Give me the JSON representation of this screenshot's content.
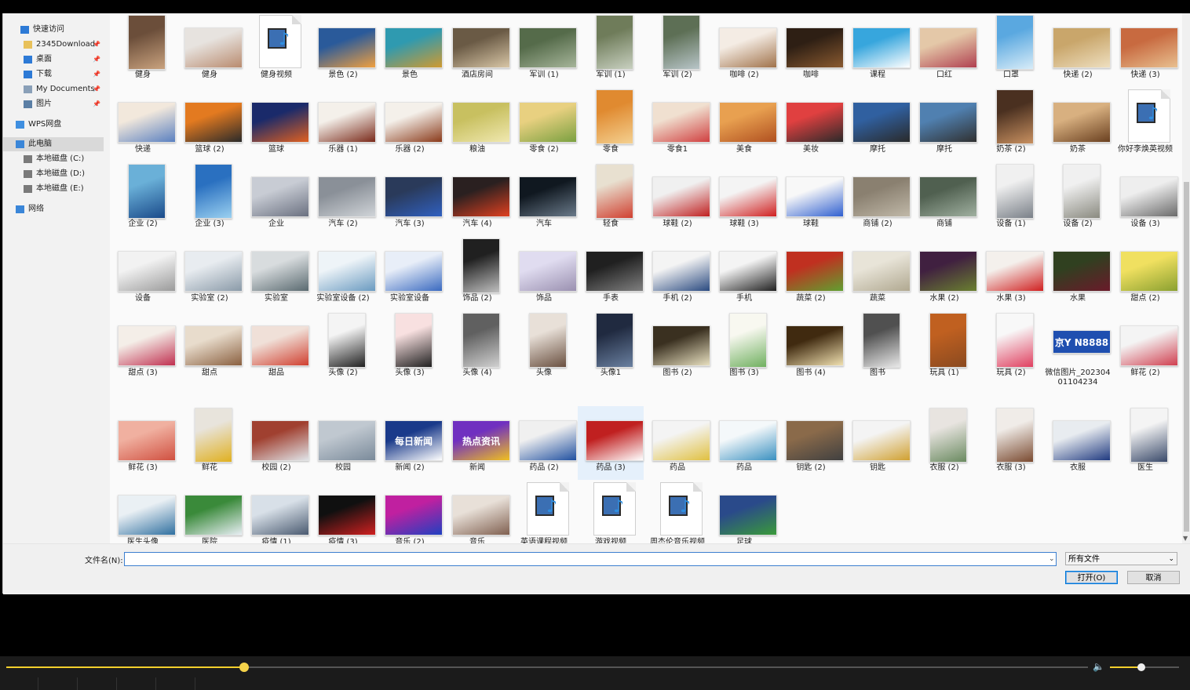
{
  "nav": {
    "items": [
      {
        "label": "快速访问",
        "icon": "star-icon",
        "color": "#2d7ad6",
        "pinned": false
      },
      {
        "label": "2345Download",
        "icon": "folder-icon",
        "color": "#e8c15a",
        "pinned": true
      },
      {
        "label": "桌面",
        "icon": "desktop-icon",
        "color": "#2d7ad6",
        "pinned": true
      },
      {
        "label": "下载",
        "icon": "download-icon",
        "color": "#2d7ad6",
        "pinned": true
      },
      {
        "label": "My Documents",
        "icon": "document-icon",
        "color": "#8aa0b8",
        "pinned": true
      },
      {
        "label": "图片",
        "icon": "pictures-icon",
        "color": "#5b7fa5",
        "pinned": true
      },
      {
        "label": "WPS网盘",
        "icon": "cloud-icon",
        "color": "#3f8fe0",
        "pinned": false
      },
      {
        "label": "此电脑",
        "icon": "computer-icon",
        "color": "#3a86d8",
        "pinned": false
      },
      {
        "label": "本地磁盘 (C:)",
        "icon": "drive-c-icon",
        "color": "#7a7a7a",
        "pinned": false
      },
      {
        "label": "本地磁盘 (D:)",
        "icon": "drive-icon",
        "color": "#7a7a7a",
        "pinned": false
      },
      {
        "label": "本地磁盘 (E:)",
        "icon": "drive-icon",
        "color": "#7a7a7a",
        "pinned": false
      },
      {
        "label": "网络",
        "icon": "network-icon",
        "color": "#3a86d8",
        "pinned": false
      }
    ],
    "pin_glyph": "📌"
  },
  "files": [
    [
      {
        "label": "健身",
        "kind": "tall",
        "c1": "#6b4e3a",
        "c2": "#c9a27e"
      },
      {
        "label": "健身",
        "kind": "image",
        "c1": "#e7e3df",
        "c2": "#b98b6f"
      },
      {
        "label": "健身视频",
        "kind": "video"
      },
      {
        "label": "景色 (2)",
        "kind": "image",
        "c1": "#2a5a9a",
        "c2": "#f0a040"
      },
      {
        "label": "景色",
        "kind": "image",
        "c1": "#2f9ab0",
        "c2": "#d09a30"
      },
      {
        "label": "酒店房间",
        "kind": "image",
        "c1": "#6a5a45",
        "c2": "#d8c6a6"
      },
      {
        "label": "军训 (1)",
        "kind": "image",
        "c1": "#556b4a",
        "c2": "#a6b59a"
      },
      {
        "label": "军训 (1)",
        "kind": "tall",
        "c1": "#6f7c5a",
        "c2": "#c8d0c0"
      },
      {
        "label": "军训 (2)",
        "kind": "tall",
        "c1": "#5d6f55",
        "c2": "#b8c5c8"
      },
      {
        "label": "咖啡 (2)",
        "kind": "image",
        "c1": "#f4ece4",
        "c2": "#a0724a"
      },
      {
        "label": "咖啡",
        "kind": "image",
        "c1": "#2e1f14",
        "c2": "#8a5a30"
      },
      {
        "label": "课程",
        "kind": "image",
        "c1": "#37a6dd",
        "c2": "#ffffff"
      },
      {
        "label": "口红",
        "kind": "image",
        "c1": "#e4c8a8",
        "c2": "#b04050"
      },
      {
        "label": "口罩",
        "kind": "tall",
        "c1": "#5aa8e0",
        "c2": "#d8ecf8"
      },
      {
        "label": "快递 (2)",
        "kind": "image",
        "c1": "#c9a66b",
        "c2": "#eedfc0"
      },
      {
        "label": "快递 (3)",
        "kind": "image",
        "c1": "#c86a40",
        "c2": "#e8c090"
      }
    ],
    [
      {
        "label": "快递",
        "kind": "image",
        "c1": "#f2e8dc",
        "c2": "#5a80c0"
      },
      {
        "label": "篮球 (2)",
        "kind": "image",
        "c1": "#e37a20",
        "c2": "#2a2a2a"
      },
      {
        "label": "篮球",
        "kind": "image",
        "c1": "#1a2a6a",
        "c2": "#e06020"
      },
      {
        "label": "乐器 (1)",
        "kind": "image",
        "c1": "#f4f0ea",
        "c2": "#7a2a1a"
      },
      {
        "label": "乐器 (2)",
        "kind": "image",
        "c1": "#f4f0ea",
        "c2": "#8a3a1a"
      },
      {
        "label": "粮油",
        "kind": "image",
        "c1": "#c8c060",
        "c2": "#f0e8b0"
      },
      {
        "label": "零食 (2)",
        "kind": "image",
        "c1": "#e8d080",
        "c2": "#7aa040"
      },
      {
        "label": "零食",
        "kind": "tall",
        "c1": "#e08a30",
        "c2": "#f4d090"
      },
      {
        "label": "零食1",
        "kind": "image",
        "c1": "#f0e0d0",
        "c2": "#d04040"
      },
      {
        "label": "美食",
        "kind": "image",
        "c1": "#e8a050",
        "c2": "#b05020"
      },
      {
        "label": "美妆",
        "kind": "image",
        "c1": "#e04040",
        "c2": "#2a2a2a"
      },
      {
        "label": "摩托",
        "kind": "image",
        "c1": "#3060a0",
        "c2": "#2a2a2a"
      },
      {
        "label": "摩托",
        "kind": "image",
        "c1": "#5080b0",
        "c2": "#303030"
      },
      {
        "label": "奶茶 (2)",
        "kind": "tall",
        "c1": "#4a3020",
        "c2": "#c89060"
      },
      {
        "label": "奶茶",
        "kind": "image",
        "c1": "#d8b080",
        "c2": "#6a4020"
      },
      {
        "label": "你好李焕英视频",
        "kind": "video"
      }
    ],
    [
      {
        "label": "企业 (2)",
        "kind": "tall",
        "c1": "#6ab0d8",
        "c2": "#1a4a8a"
      },
      {
        "label": "企业 (3)",
        "kind": "tall",
        "c1": "#2a70c0",
        "c2": "#9ad0f0"
      },
      {
        "label": "企业",
        "kind": "image",
        "c1": "#c8ccd4",
        "c2": "#6a7080"
      },
      {
        "label": "汽车 (2)",
        "kind": "image",
        "c1": "#8a9098",
        "c2": "#d0d4d8"
      },
      {
        "label": "汽车 (3)",
        "kind": "image",
        "c1": "#2a3a5a",
        "c2": "#3060c0"
      },
      {
        "label": "汽车 (4)",
        "kind": "image",
        "c1": "#2a2020",
        "c2": "#e04020"
      },
      {
        "label": "汽车",
        "kind": "image",
        "c1": "#101820",
        "c2": "#6a7a8a"
      },
      {
        "label": "轻食",
        "kind": "tall",
        "c1": "#e8e0d0",
        "c2": "#d04030"
      },
      {
        "label": "球鞋 (2)",
        "kind": "image",
        "c1": "#f0f0f0",
        "c2": "#c02020"
      },
      {
        "label": "球鞋 (3)",
        "kind": "image",
        "c1": "#f4f4f4",
        "c2": "#d02020"
      },
      {
        "label": "球鞋",
        "kind": "image",
        "c1": "#f8f8f8",
        "c2": "#3060d0"
      },
      {
        "label": "商铺 (2)",
        "kind": "image",
        "c1": "#8a8070",
        "c2": "#c0b8a8"
      },
      {
        "label": "商铺",
        "kind": "image",
        "c1": "#506050",
        "c2": "#a0b0a0"
      },
      {
        "label": "设备 (1)",
        "kind": "tall",
        "c1": "#f0f0f0",
        "c2": "#7a8088"
      },
      {
        "label": "设备 (2)",
        "kind": "tall",
        "c1": "#f0f0f0",
        "c2": "#8a8a80"
      },
      {
        "label": "设备 (3)",
        "kind": "image",
        "c1": "#eeeeee",
        "c2": "#6a6a6a"
      }
    ],
    [
      {
        "label": "设备",
        "kind": "image",
        "c1": "#f2f2f2",
        "c2": "#9a9a9a"
      },
      {
        "label": "实验室 (2)",
        "kind": "image",
        "c1": "#e8ecf0",
        "c2": "#8a9aa8"
      },
      {
        "label": "实验室",
        "kind": "image",
        "c1": "#d8dcde",
        "c2": "#5a6a70"
      },
      {
        "label": "实验室设备 (2)",
        "kind": "image",
        "c1": "#eef4f8",
        "c2": "#6a9ac0"
      },
      {
        "label": "实验室设备",
        "kind": "image",
        "c1": "#e8eef8",
        "c2": "#3a6ac0"
      },
      {
        "label": "饰品 (2)",
        "kind": "tall",
        "c1": "#202020",
        "c2": "#c0c0c0"
      },
      {
        "label": "饰品",
        "kind": "image",
        "c1": "#e0dcf0",
        "c2": "#9a90b0"
      },
      {
        "label": "手表",
        "kind": "image",
        "c1": "#202020",
        "c2": "#808080"
      },
      {
        "label": "手机 (2)",
        "kind": "image",
        "c1": "#f4f4f4",
        "c2": "#2a4a80"
      },
      {
        "label": "手机",
        "kind": "image",
        "c1": "#f4f4f4",
        "c2": "#202020"
      },
      {
        "label": "蔬菜 (2)",
        "kind": "image",
        "c1": "#c03020",
        "c2": "#60a030"
      },
      {
        "label": "蔬菜",
        "kind": "image",
        "c1": "#e8e4d8",
        "c2": "#b0a890"
      },
      {
        "label": "水果 (2)",
        "kind": "image",
        "c1": "#402040",
        "c2": "#6a8030"
      },
      {
        "label": "水果 (3)",
        "kind": "image",
        "c1": "#f4f0ec",
        "c2": "#d02020"
      },
      {
        "label": "水果",
        "kind": "image",
        "c1": "#304020",
        "c2": "#6a1a2a"
      },
      {
        "label": "甜点 (2)",
        "kind": "image",
        "c1": "#f0e060",
        "c2": "#8aa030"
      }
    ],
    [
      {
        "label": "甜点 (3)",
        "kind": "image",
        "c1": "#f4eee8",
        "c2": "#c03050"
      },
      {
        "label": "甜点",
        "kind": "image",
        "c1": "#e8dccc",
        "c2": "#8a6040"
      },
      {
        "label": "甜品",
        "kind": "image",
        "c1": "#f0e0d8",
        "c2": "#d04030"
      },
      {
        "label": "头像 (2)",
        "kind": "tall",
        "c1": "#f4f4f4",
        "c2": "#202020"
      },
      {
        "label": "头像 (3)",
        "kind": "tall",
        "c1": "#f8e0e0",
        "c2": "#202020"
      },
      {
        "label": "头像 (4)",
        "kind": "tall",
        "c1": "#606060",
        "c2": "#d0d0d0"
      },
      {
        "label": "头像",
        "kind": "tall",
        "c1": "#e8e0d8",
        "c2": "#6a5040"
      },
      {
        "label": "头像1",
        "kind": "tall",
        "c1": "#202a40",
        "c2": "#6a80a0"
      },
      {
        "label": "图书 (2)",
        "kind": "image",
        "c1": "#3a3020",
        "c2": "#e8e0c0"
      },
      {
        "label": "图书 (3)",
        "kind": "tall",
        "c1": "#f8f8f0",
        "c2": "#70b060"
      },
      {
        "label": "图书 (4)",
        "kind": "image",
        "c1": "#402a10",
        "c2": "#f0e0b0"
      },
      {
        "label": "图书",
        "kind": "tall",
        "c1": "#505050",
        "c2": "#e8e8e8"
      },
      {
        "label": "玩具 (1)",
        "kind": "tall",
        "c1": "#c06020",
        "c2": "#8a4a20"
      },
      {
        "label": "玩具 (2)",
        "kind": "tall",
        "c1": "#f8f8f8",
        "c2": "#e04060"
      },
      {
        "label": "微信图片_20230401104234",
        "kind": "plate",
        "plate": "京Y N8888"
      },
      {
        "label": "鲜花 (2)",
        "kind": "image",
        "c1": "#f4f4f4",
        "c2": "#d04050"
      }
    ],
    [
      {
        "label": "鲜花 (3)",
        "kind": "image",
        "c1": "#f0b0a0",
        "c2": "#d05040"
      },
      {
        "label": "鲜花",
        "kind": "tall",
        "c1": "#e8e4dc",
        "c2": "#e0b020"
      },
      {
        "label": "校园 (2)",
        "kind": "image",
        "c1": "#a04030",
        "c2": "#e0e4e8"
      },
      {
        "label": "校园",
        "kind": "image",
        "c1": "#c0c8d0",
        "c2": "#7a8a9a"
      },
      {
        "label": "新闻 (2)",
        "kind": "image",
        "c1": "#1a3a8a",
        "c2": "#ffffff",
        "text": "每日新闻"
      },
      {
        "label": "新闻",
        "kind": "image",
        "c1": "#7030c0",
        "c2": "#f0c020",
        "text": "热点资讯"
      },
      {
        "label": "药品 (2)",
        "kind": "image",
        "c1": "#f0f0f0",
        "c2": "#2050a0"
      },
      {
        "label": "药品 (3)",
        "kind": "image",
        "c1": "#c02020",
        "c2": "#ffffff"
      },
      {
        "label": "药品",
        "kind": "image",
        "c1": "#f4f4f4",
        "c2": "#e0c040"
      },
      {
        "label": "药品",
        "kind": "image",
        "c1": "#f4f8fa",
        "c2": "#3a90c0"
      },
      {
        "label": "钥匙 (2)",
        "kind": "image",
        "c1": "#8a6a4a",
        "c2": "#404040"
      },
      {
        "label": "钥匙",
        "kind": "image",
        "c1": "#f4f4f4",
        "c2": "#d0a030"
      },
      {
        "label": "衣服 (2)",
        "kind": "tall",
        "c1": "#e8e4e0",
        "c2": "#6a8a60"
      },
      {
        "label": "衣服 (3)",
        "kind": "tall",
        "c1": "#f0ece8",
        "c2": "#7a4a30"
      },
      {
        "label": "衣服",
        "kind": "image",
        "c1": "#e8ecf0",
        "c2": "#203a80"
      },
      {
        "label": "医生",
        "kind": "tall",
        "c1": "#f4f4f4",
        "c2": "#3a4a6a"
      }
    ],
    [
      {
        "label": "医生头像",
        "kind": "image",
        "c1": "#eaf0f4",
        "c2": "#3070a0"
      },
      {
        "label": "医院",
        "kind": "image",
        "c1": "#3a8a3a",
        "c2": "#e8eef4"
      },
      {
        "label": "疫情 (1)",
        "kind": "image",
        "c1": "#d8e0e8",
        "c2": "#4a5a70"
      },
      {
        "label": "疫情 (3)",
        "kind": "image",
        "c1": "#101010",
        "c2": "#d02020"
      },
      {
        "label": "音乐 (2)",
        "kind": "image",
        "c1": "#c020a0",
        "c2": "#2040c0"
      },
      {
        "label": "音乐",
        "kind": "image",
        "c1": "#e8e0d8",
        "c2": "#806050"
      },
      {
        "label": "英语课程视频",
        "kind": "video"
      },
      {
        "label": "游戏视频",
        "kind": "video"
      },
      {
        "label": "周杰伦音乐视频",
        "kind": "video"
      },
      {
        "label": "足球",
        "kind": "image",
        "c1": "#2a4a8a",
        "c2": "#3a9a3a"
      }
    ]
  ],
  "selected": {
    "row": 5,
    "col": 7
  },
  "footer": {
    "filename_label": "文件名(N):",
    "filename_value": "",
    "filetype": "所有文件",
    "open": "打开(O)",
    "cancel": "取消"
  },
  "player": {
    "progress": 0.22,
    "volume": 0.45,
    "accent": "#f3cf2c",
    "volume_icon": "volume-icon"
  }
}
